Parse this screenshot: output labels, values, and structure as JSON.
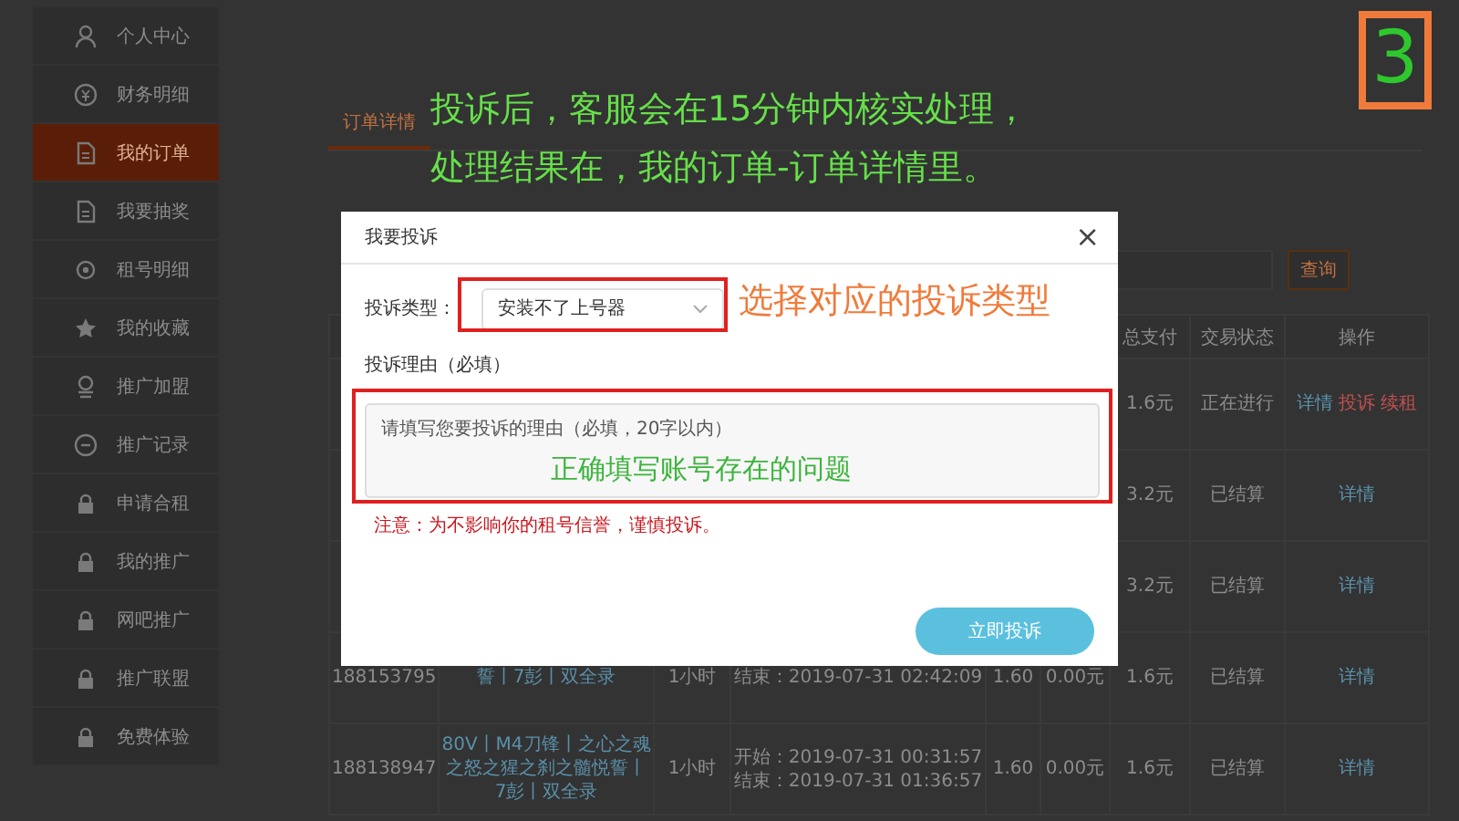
{
  "sidebar": {
    "items": [
      {
        "label": "个人中心",
        "selected": false
      },
      {
        "label": "财务明细",
        "selected": false
      },
      {
        "label": "我的订单",
        "selected": true
      },
      {
        "label": "我要抽奖",
        "selected": false
      },
      {
        "label": "租号明细",
        "selected": false
      },
      {
        "label": "我的收藏",
        "selected": false
      },
      {
        "label": "推广加盟",
        "selected": false
      },
      {
        "label": "推广记录",
        "selected": false
      },
      {
        "label": "申请合租",
        "selected": false
      },
      {
        "label": "我的推广",
        "selected": false
      },
      {
        "label": "网吧推广",
        "selected": false
      },
      {
        "label": "推广联盟",
        "selected": false
      },
      {
        "label": "免费体验",
        "selected": false
      }
    ]
  },
  "tabs": [
    {
      "label": "订单详情",
      "selected": true
    }
  ],
  "search": {
    "button": "查询"
  },
  "table": {
    "columns": [
      {
        "label": "总支付"
      },
      {
        "label": "交易状态"
      },
      {
        "label": "操作"
      }
    ],
    "rows": [
      {
        "total": "1.6元",
        "status": "正在进行",
        "actions": [
          {
            "label": "详情",
            "kind": "detail"
          },
          {
            "label": "投诉",
            "kind": "danger"
          },
          {
            "label": "续租",
            "kind": "danger"
          }
        ]
      },
      {
        "total": "3.2元",
        "status": "已结算",
        "actions": [
          {
            "label": "详情",
            "kind": "detail"
          }
        ]
      },
      {
        "total": "3.2元",
        "status": "已结算",
        "actions": [
          {
            "label": "详情",
            "kind": "detail"
          }
        ]
      },
      {
        "order_no": "188153795",
        "product": "誓丨7彭丨双全录",
        "duration": "1小时",
        "time": [
          "结束：2019-07-31 02:42:09"
        ],
        "price": "1.60",
        "discount": "0.00元",
        "total": "1.6元",
        "status": "已结算",
        "actions": [
          {
            "label": "详情",
            "kind": "detail"
          }
        ]
      },
      {
        "order_no": "188138947",
        "product": "80V丨M4刀锋丨之心之魂之怒之猩之刹之髓悦誓丨7彭丨双全录",
        "duration": "1小时",
        "time": [
          "开始：2019-07-31 00:31:57",
          "结束：2019-07-31 01:36:57"
        ],
        "price": "1.60",
        "discount": "0.00元",
        "total": "1.6元",
        "status": "已结算",
        "actions": [
          {
            "label": "详情",
            "kind": "detail"
          }
        ]
      }
    ]
  },
  "modal": {
    "title": "我要投诉",
    "close": "×",
    "type_label": "投诉类型：",
    "type_value": "安装不了上号器",
    "reason_label": "投诉理由（必填）",
    "reason_placeholder": "请填写您要投诉的理由（必填，20字以内）",
    "notice": "注意：为不影响你的租号信誉，谨慎投诉。",
    "submit": "立即投诉"
  },
  "annotations": {
    "step": "3",
    "headline": [
      "投诉后，客服会在15分钟内核实处理，",
      "处理结果在，我的订单-订单详情里。"
    ],
    "select_hint": "选择对应的投诉类型",
    "reason_hint": "正确填写账号存在的问题"
  }
}
